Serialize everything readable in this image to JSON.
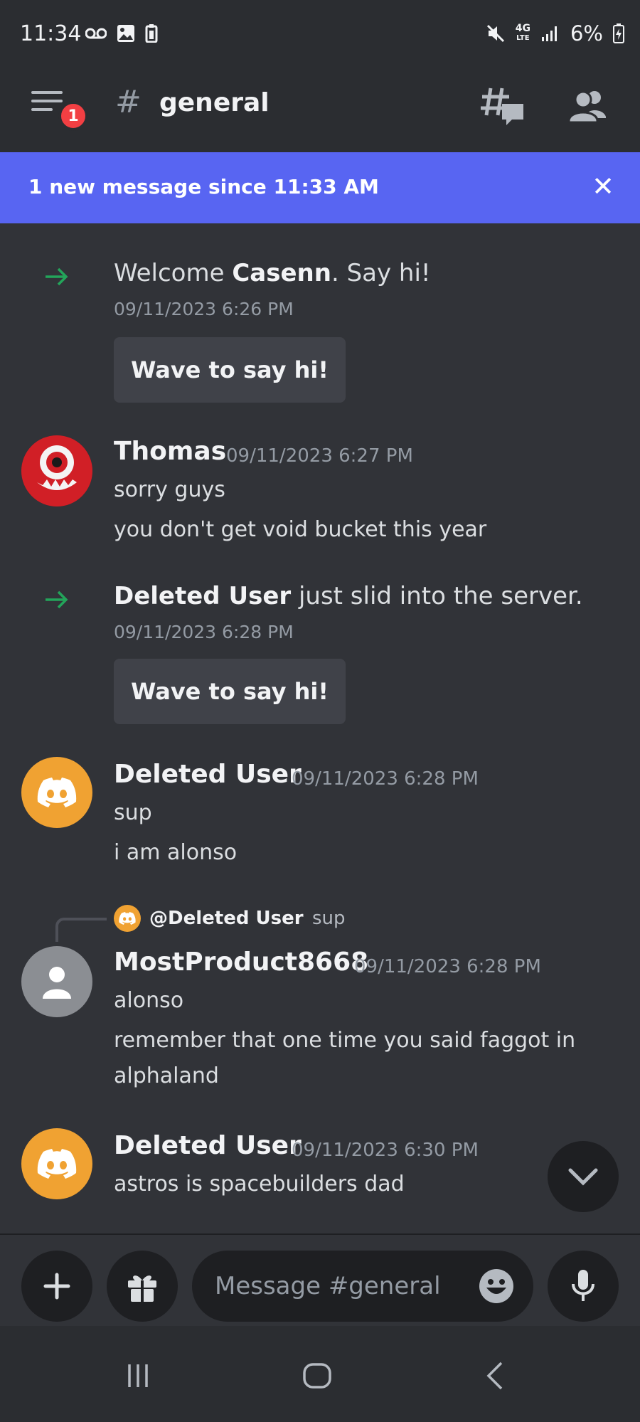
{
  "status_bar": {
    "time": "11:34",
    "battery": "6%",
    "icons": [
      "voicemail-icon",
      "image-icon",
      "clipboard-icon",
      "mute-icon",
      "4g-lte-icon",
      "signal-icon",
      "battery-charging-icon"
    ]
  },
  "header": {
    "menu_badge": "1",
    "hash": "#",
    "channel_name": "general"
  },
  "new_messages_bar": {
    "text": "1 new message since 11:33 AM",
    "close": "✕"
  },
  "messages": [
    {
      "type": "system",
      "prefix": "Welcome ",
      "user": "Casenn",
      "suffix": ". Say hi!",
      "time": "09/11/2023 6:26 PM",
      "button": "Wave to say hi!"
    },
    {
      "type": "message",
      "user": "Thomas",
      "time": "09/11/2023 6:27 PM",
      "lines": [
        "sorry guys",
        "you don't get void bucket this year"
      ]
    },
    {
      "type": "system",
      "user": "Deleted User",
      "suffix": " just slid into the server.",
      "time": "09/11/2023 6:28 PM",
      "button": "Wave to say hi!"
    },
    {
      "type": "message",
      "user": "Deleted User",
      "time": "09/11/2023 6:28 PM",
      "lines": [
        "sup",
        "i am alonso"
      ]
    },
    {
      "type": "reply",
      "reply_to": "@Deleted User",
      "reply_text": "sup",
      "user": "MostProduct8668",
      "time": "09/11/2023 6:28 PM",
      "lines": [
        "alonso",
        "remember that one time you said faggot in",
        "alphaland"
      ]
    },
    {
      "type": "message",
      "user": "Deleted User",
      "time": "09/11/2023 6:30 PM",
      "lines": [
        "astros is spacebuilders dad"
      ]
    }
  ],
  "composer": {
    "placeholder": "Message #general"
  },
  "colors": {
    "background": "#313338",
    "header": "#2b2d31",
    "blurple": "#5865f2",
    "discord_orange": "#f0a232",
    "join_green": "#23a55a",
    "badge_red": "#f23f43"
  }
}
